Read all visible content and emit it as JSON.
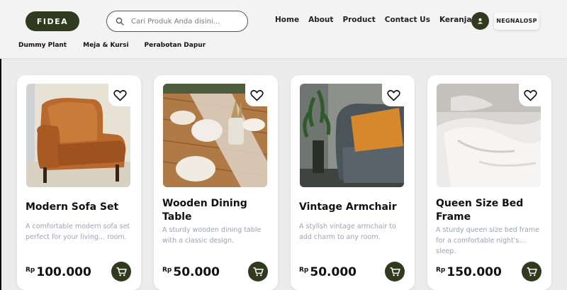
{
  "brand": {
    "logo": "FIDEA"
  },
  "search": {
    "placeholder": "Cari Produk Anda disini..."
  },
  "nav": [
    "Home",
    "About",
    "Product",
    "Contact Us",
    "Keranjang"
  ],
  "user": {
    "name": "NEGNALOSP"
  },
  "categories": [
    "Dummy Plant",
    "Meja & Kursi",
    "Perabotan Dapur"
  ],
  "currency": "Rp",
  "products": [
    {
      "title": "Modern Sofa Set",
      "desc": "A comfortable modern sofa set perfect for your living... room.",
      "price": "100.000"
    },
    {
      "title": "Wooden Dining Table",
      "desc": "A sturdy wooden dining table with a classic design.",
      "price": "50.000"
    },
    {
      "title": "Vintage Armchair",
      "desc": "A stylish vintage armchair to add charm to any room.",
      "price": "50.000"
    },
    {
      "title": "Queen Size Bed Frame",
      "desc": "A sturdy queen size bed frame for a comfortable night's... sleep.",
      "price": "150.000"
    }
  ],
  "colors": {
    "accent": "#2f3a1e",
    "desc_text": "#9aa3b8",
    "background": "#ececec"
  },
  "icons": [
    "search-icon",
    "user-icon",
    "heart-icon",
    "cart-icon"
  ]
}
